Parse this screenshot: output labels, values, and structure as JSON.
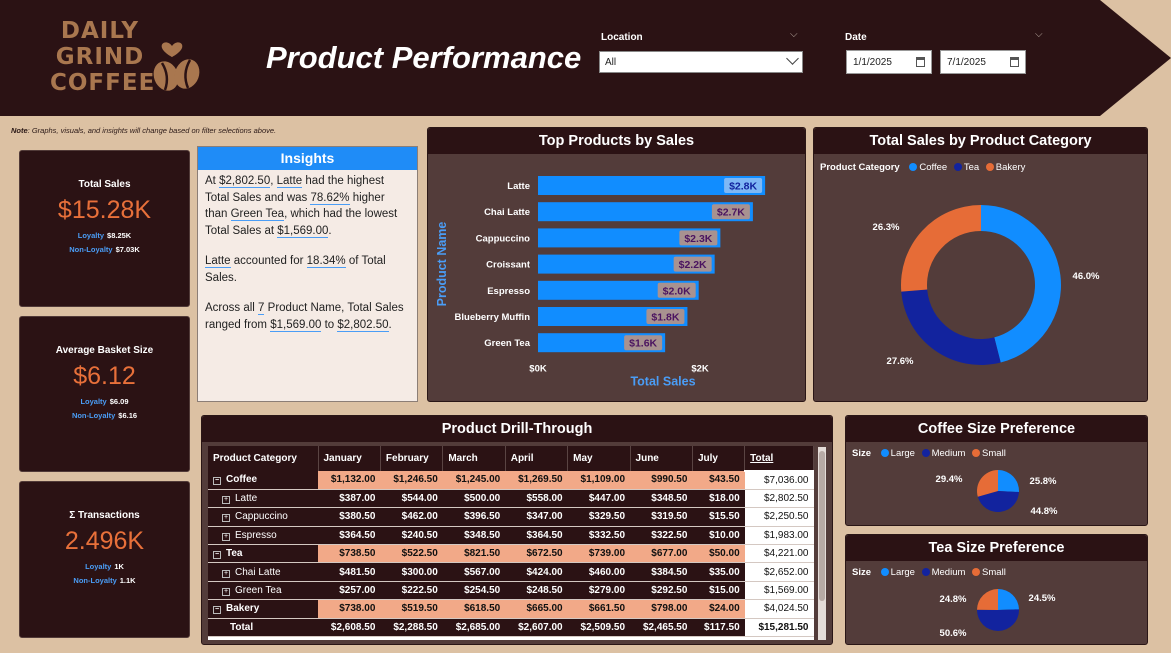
{
  "brand": {
    "line1": "DAILY",
    "line2": "GRIND",
    "line3": "COFFEE"
  },
  "header": {
    "title": "Product Performance",
    "location_label": "Location",
    "location_value": "All",
    "date_label": "Date",
    "date_start": "1/1/2025",
    "date_end": "7/1/2025"
  },
  "note": {
    "prefix": "Note",
    "text": ": Graphs, visuals, and insights will change based on filter selections above."
  },
  "kpis": [
    {
      "title": "Total Sales",
      "value": "$15.28K",
      "loyalty_label": "Loyalty",
      "loyalty": "$8.25K",
      "nonloyalty_label": "Non-Loyalty",
      "nonloyalty": "$7.03K"
    },
    {
      "title": "Average Basket Size",
      "value": "$6.12",
      "loyalty_label": "Loyalty",
      "loyalty": "$6.09",
      "nonloyalty_label": "Non-Loyalty",
      "nonloyalty": "$6.16"
    },
    {
      "title": "Σ Transactions",
      "value": "2.496K",
      "loyalty_label": "Loyalty",
      "loyalty": "1K",
      "nonloyalty_label": "Non-Loyalty",
      "nonloyalty": "1.1K"
    }
  ],
  "insights": {
    "title": "Insights",
    "p1": [
      "At ",
      "$2,802.50",
      ", ",
      "Latte",
      " had the highest Total Sales and was ",
      "78.62%",
      " higher than ",
      "Green Tea",
      ", which had the lowest Total Sales at ",
      "$1,569.00",
      "."
    ],
    "p2": [
      "Latte",
      " accounted for ",
      "18.34%",
      " of Total Sales."
    ],
    "p3": [
      "Across all ",
      "7",
      " Product Name, Total Sales ranged from ",
      "$1,569.00",
      " to ",
      "$2,802.50",
      "."
    ]
  },
  "colors": {
    "coffee": "#118dff",
    "tea": "#12239e",
    "bakery": "#e66c37",
    "accent": "#e8703a"
  },
  "chart_data": [
    {
      "type": "bar",
      "title": "Top Products by Sales",
      "xlabel": "Total Sales",
      "ylabel": "Product Name",
      "categories": [
        "Latte",
        "Chai Latte",
        "Cappuccino",
        "Croissant",
        "Espresso",
        "Blueberry Muffin",
        "Green Tea"
      ],
      "values": [
        2802.5,
        2652.0,
        2250.5,
        2180.0,
        1983.0,
        1844.0,
        1569.0
      ],
      "data_labels": [
        "$2.8K",
        "$2.7K",
        "$2.3K",
        "$2.2K",
        "$2.0K",
        "$1.8K",
        "$1.6K"
      ],
      "xticks": [
        "$0K",
        "$2K"
      ],
      "xlim": [
        0,
        2900
      ]
    },
    {
      "type": "pie",
      "title": "Total Sales by Product Category",
      "legend_title": "Product Category",
      "labels": [
        "Coffee",
        "Tea",
        "Bakery"
      ],
      "values": [
        46.0,
        27.6,
        26.3
      ],
      "data_labels": [
        "46.0%",
        "27.6%",
        "26.3%"
      ]
    },
    {
      "type": "pie",
      "title": "Coffee Size Preference",
      "legend_title": "Size",
      "labels": [
        "Large",
        "Medium",
        "Small"
      ],
      "values": [
        25.8,
        44.8,
        29.4
      ],
      "data_labels": [
        "25.8%",
        "44.8%",
        "29.4%"
      ]
    },
    {
      "type": "pie",
      "title": "Tea Size Preference",
      "legend_title": "Size",
      "labels": [
        "Large",
        "Medium",
        "Small"
      ],
      "values": [
        24.5,
        50.6,
        24.8
      ],
      "data_labels": [
        "24.5%",
        "50.6%",
        "24.8%"
      ]
    },
    {
      "type": "table",
      "title": "Product Drill-Through",
      "columns": [
        "Product Category",
        "January",
        "February",
        "March",
        "April",
        "May",
        "June",
        "July",
        "Total"
      ],
      "rows": [
        {
          "kind": "cat",
          "name": "Coffee",
          "values": [
            "$1,132.00",
            "$1,246.50",
            "$1,245.00",
            "$1,269.50",
            "$1,109.00",
            "$990.50",
            "$43.50",
            "$7,036.00"
          ]
        },
        {
          "kind": "sub",
          "name": "Latte",
          "values": [
            "$387.00",
            "$544.00",
            "$500.00",
            "$558.00",
            "$447.00",
            "$348.50",
            "$18.00",
            "$2,802.50"
          ]
        },
        {
          "kind": "sub",
          "name": "Cappuccino",
          "values": [
            "$380.50",
            "$462.00",
            "$396.50",
            "$347.00",
            "$329.50",
            "$319.50",
            "$15.50",
            "$2,250.50"
          ]
        },
        {
          "kind": "sub",
          "name": "Espresso",
          "values": [
            "$364.50",
            "$240.50",
            "$348.50",
            "$364.50",
            "$332.50",
            "$322.50",
            "$10.00",
            "$1,983.00"
          ]
        },
        {
          "kind": "cat",
          "name": "Tea",
          "values": [
            "$738.50",
            "$522.50",
            "$821.50",
            "$672.50",
            "$739.00",
            "$677.00",
            "$50.00",
            "$4,221.00"
          ]
        },
        {
          "kind": "sub",
          "name": "Chai Latte",
          "values": [
            "$481.50",
            "$300.00",
            "$567.00",
            "$424.00",
            "$460.00",
            "$384.50",
            "$35.00",
            "$2,652.00"
          ]
        },
        {
          "kind": "sub",
          "name": "Green Tea",
          "values": [
            "$257.00",
            "$222.50",
            "$254.50",
            "$248.50",
            "$279.00",
            "$292.50",
            "$15.00",
            "$1,569.00"
          ]
        },
        {
          "kind": "cat",
          "name": "Bakery",
          "values": [
            "$738.00",
            "$519.50",
            "$618.50",
            "$665.00",
            "$661.50",
            "$798.00",
            "$24.00",
            "$4,024.50"
          ]
        },
        {
          "kind": "tot",
          "name": "Total",
          "values": [
            "$2,608.50",
            "$2,288.50",
            "$2,685.00",
            "$2,607.00",
            "$2,509.50",
            "$2,465.50",
            "$117.50",
            "$15,281.50"
          ]
        }
      ]
    }
  ]
}
